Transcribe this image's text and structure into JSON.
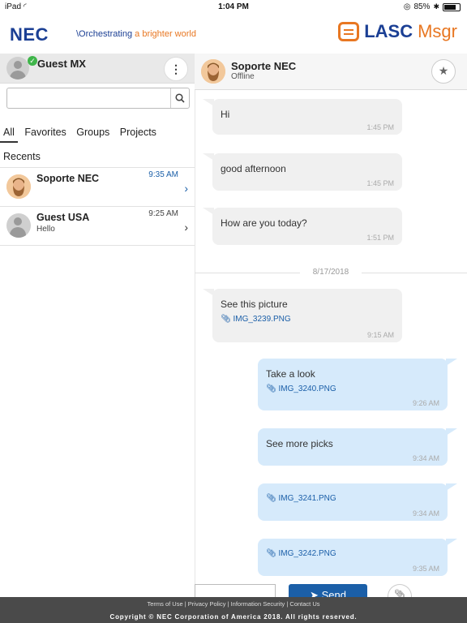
{
  "status_bar": {
    "device": "iPad",
    "time": "1:04 PM",
    "battery": "85%",
    "battery_level": 0.85
  },
  "header": {
    "nec_logo": "NEC",
    "tagline_prefix": "\\Orchestrating",
    "tagline_suffix": "a brighter world",
    "app_logo_main": "LASC",
    "app_logo_suffix": "Msgr"
  },
  "sidebar": {
    "user_name": "Guest MX",
    "search": {
      "value": "",
      "placeholder": ""
    },
    "tabs": [
      "All",
      "Favorites",
      "Groups",
      "Projects"
    ],
    "tab_recents": "Recents",
    "contacts": [
      {
        "name": "Soporte NEC",
        "time": "9:35 AM",
        "preview": ""
      },
      {
        "name": "Guest USA",
        "time": "9:25 AM",
        "preview": "Hello"
      }
    ]
  },
  "chat_header": {
    "name": "Soporte NEC",
    "status": "Offline"
  },
  "messages": [
    {
      "dir": "in",
      "text": "Hi",
      "time": "1:45 PM"
    },
    {
      "dir": "in",
      "text": "good afternoon",
      "time": "1:45 PM"
    },
    {
      "dir": "in",
      "text": "How are you today?",
      "time": "1:51 PM"
    },
    {
      "dir": "in",
      "text": "See this picture",
      "attachment": "IMG_3239.PNG",
      "time": "9:15 AM"
    },
    {
      "dir": "out",
      "text": "Take a look",
      "attachment": "IMG_3240.PNG",
      "time": "9:26 AM"
    },
    {
      "dir": "out",
      "text": "See more picks",
      "time": "9:34 AM"
    },
    {
      "dir": "out",
      "attachment": "IMG_3241.PNG",
      "time": "9:34 AM"
    },
    {
      "dir": "out",
      "attachment": "IMG_3242.PNG",
      "time": "9:35 AM"
    }
  ],
  "date_separator": "8/17/2018",
  "composer": {
    "send_label": "Send"
  },
  "footer": {
    "links": [
      "Terms of Use",
      "Privacy Policy",
      "Information Security",
      "Contact Us"
    ],
    "copyright": "Copyright © NEC Corporation of America 2018. All rights reserved."
  },
  "colors": {
    "brand_blue": "#1b3f94",
    "accent_orange": "#e87722",
    "link_blue": "#1b5fa8",
    "online_green": "#3fb54a",
    "outgoing_bubble": "#d6eafb",
    "incoming_bubble": "#f0f0f0"
  },
  "icons": [
    "wifi-icon",
    "lock-rotation-icon",
    "bluetooth-icon",
    "battery-icon",
    "kebab-menu-icon",
    "search-icon",
    "chevron-right-icon",
    "star-icon",
    "paperclip-icon",
    "send-icon",
    "avatar-icon"
  ]
}
